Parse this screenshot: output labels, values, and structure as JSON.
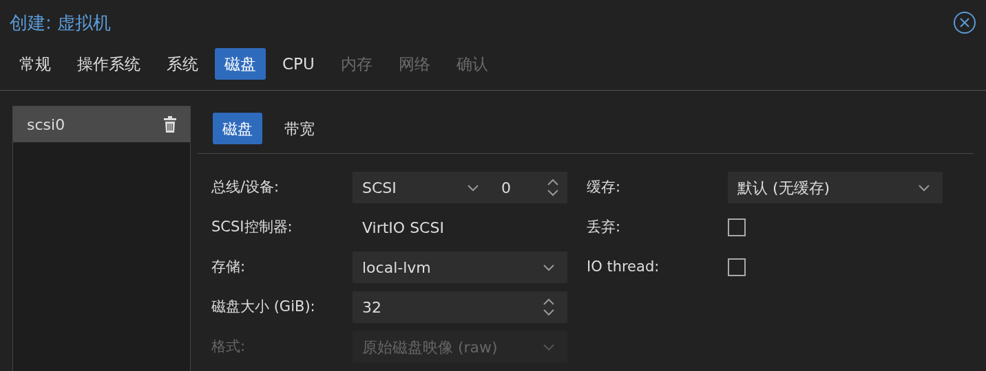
{
  "window": {
    "title": "创建: 虚拟机"
  },
  "tabs": [
    {
      "label": "常规",
      "selected": false,
      "disabled": false
    },
    {
      "label": "操作系统",
      "selected": false,
      "disabled": false
    },
    {
      "label": "系统",
      "selected": false,
      "disabled": false
    },
    {
      "label": "磁盘",
      "selected": true,
      "disabled": false
    },
    {
      "label": "CPU",
      "selected": false,
      "disabled": false
    },
    {
      "label": "内存",
      "selected": false,
      "disabled": true
    },
    {
      "label": "网络",
      "selected": false,
      "disabled": true
    },
    {
      "label": "确认",
      "selected": false,
      "disabled": true
    }
  ],
  "disk_list": [
    {
      "label": "scsi0",
      "selected": true
    }
  ],
  "subtabs": [
    {
      "label": "磁盘",
      "selected": true
    },
    {
      "label": "带宽",
      "selected": false
    }
  ],
  "form_left": [
    {
      "kind": "combo",
      "label": "总线/设备:",
      "value": "SCSI",
      "number": "0",
      "disabled": false
    },
    {
      "kind": "display",
      "label": "SCSI控制器:",
      "value": "VirtIO SCSI",
      "disabled": false
    },
    {
      "kind": "select",
      "label": "存储:",
      "value": "local-lvm",
      "disabled": false
    },
    {
      "kind": "spinner",
      "label": "磁盘大小 (GiB):",
      "value": "32",
      "disabled": false
    },
    {
      "kind": "select",
      "label": "格式:",
      "value": "原始磁盘映像 (raw)",
      "disabled": true
    }
  ],
  "form_right": [
    {
      "kind": "select",
      "label": "缓存:",
      "value": "默认 (无缓存)",
      "disabled": false
    },
    {
      "kind": "checkbox",
      "label": "丢弃:",
      "checked": false,
      "disabled": false
    },
    {
      "kind": "checkbox",
      "label": "IO thread:",
      "checked": false,
      "disabled": false
    }
  ]
}
